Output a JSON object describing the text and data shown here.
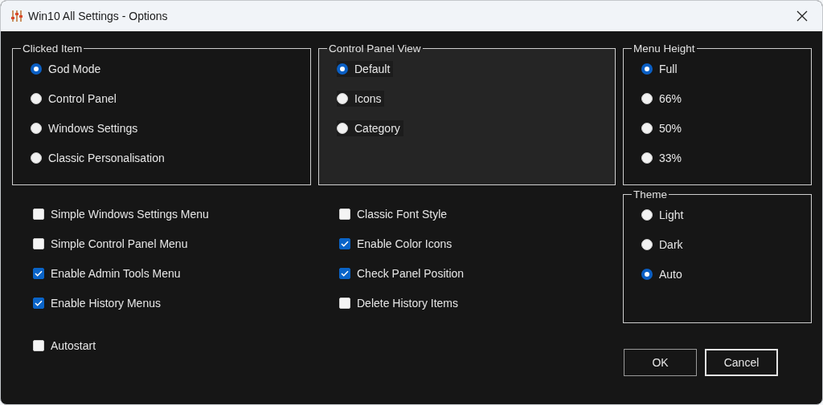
{
  "window": {
    "title": "Win10 All Settings - Options"
  },
  "groups": [
    {
      "label": "Clicked Item",
      "shaded": false,
      "options": [
        {
          "label": "God Mode",
          "selected": true
        },
        {
          "label": "Control Panel",
          "selected": false
        },
        {
          "label": "Windows Settings",
          "selected": false
        },
        {
          "label": "Classic Personalisation",
          "selected": false
        }
      ]
    },
    {
      "label": "Control Panel View",
      "shaded": true,
      "options": [
        {
          "label": "Default",
          "selected": true
        },
        {
          "label": "Icons",
          "selected": false
        },
        {
          "label": "Category",
          "selected": false
        }
      ]
    },
    {
      "label": "Menu Height",
      "shaded": false,
      "options": [
        {
          "label": "Full",
          "selected": true
        },
        {
          "label": "66%",
          "selected": false
        },
        {
          "label": "50%",
          "selected": false
        },
        {
          "label": "33%",
          "selected": false
        }
      ]
    }
  ],
  "checkbox_columns": [
    [
      {
        "label": "Simple Windows Settings Menu",
        "checked": false
      },
      {
        "label": "Simple Control Panel Menu",
        "checked": false
      },
      {
        "label": "Enable Admin Tools Menu",
        "checked": true
      },
      {
        "label": "Enable History Menus",
        "checked": true
      }
    ],
    [
      {
        "label": "Classic Font Style",
        "checked": false
      },
      {
        "label": "Enable Color Icons",
        "checked": true
      },
      {
        "label": "Check Panel Position",
        "checked": true
      },
      {
        "label": "Delete History Items",
        "checked": false
      }
    ]
  ],
  "theme": {
    "label": "Theme",
    "options": [
      {
        "label": "Light",
        "selected": false
      },
      {
        "label": "Dark",
        "selected": false
      },
      {
        "label": "Auto",
        "selected": true
      }
    ]
  },
  "autostart": {
    "label": "Autostart",
    "checked": false
  },
  "buttons": [
    {
      "label": "OK",
      "default": false
    },
    {
      "label": "Cancel",
      "default": true
    }
  ]
}
